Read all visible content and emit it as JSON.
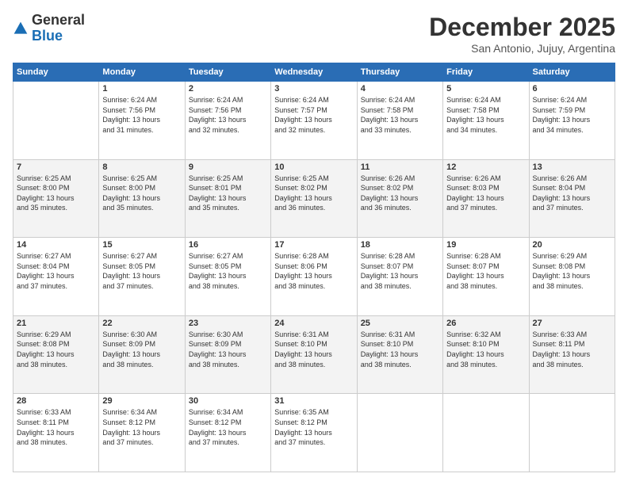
{
  "logo": {
    "general": "General",
    "blue": "Blue"
  },
  "header": {
    "month": "December 2025",
    "location": "San Antonio, Jujuy, Argentina"
  },
  "weekdays": [
    "Sunday",
    "Monday",
    "Tuesday",
    "Wednesday",
    "Thursday",
    "Friday",
    "Saturday"
  ],
  "weeks": [
    [
      {
        "day": "",
        "info": ""
      },
      {
        "day": "1",
        "info": "Sunrise: 6:24 AM\nSunset: 7:56 PM\nDaylight: 13 hours\nand 31 minutes."
      },
      {
        "day": "2",
        "info": "Sunrise: 6:24 AM\nSunset: 7:56 PM\nDaylight: 13 hours\nand 32 minutes."
      },
      {
        "day": "3",
        "info": "Sunrise: 6:24 AM\nSunset: 7:57 PM\nDaylight: 13 hours\nand 32 minutes."
      },
      {
        "day": "4",
        "info": "Sunrise: 6:24 AM\nSunset: 7:58 PM\nDaylight: 13 hours\nand 33 minutes."
      },
      {
        "day": "5",
        "info": "Sunrise: 6:24 AM\nSunset: 7:58 PM\nDaylight: 13 hours\nand 34 minutes."
      },
      {
        "day": "6",
        "info": "Sunrise: 6:24 AM\nSunset: 7:59 PM\nDaylight: 13 hours\nand 34 minutes."
      }
    ],
    [
      {
        "day": "7",
        "info": "Sunrise: 6:25 AM\nSunset: 8:00 PM\nDaylight: 13 hours\nand 35 minutes."
      },
      {
        "day": "8",
        "info": "Sunrise: 6:25 AM\nSunset: 8:00 PM\nDaylight: 13 hours\nand 35 minutes."
      },
      {
        "day": "9",
        "info": "Sunrise: 6:25 AM\nSunset: 8:01 PM\nDaylight: 13 hours\nand 35 minutes."
      },
      {
        "day": "10",
        "info": "Sunrise: 6:25 AM\nSunset: 8:02 PM\nDaylight: 13 hours\nand 36 minutes."
      },
      {
        "day": "11",
        "info": "Sunrise: 6:26 AM\nSunset: 8:02 PM\nDaylight: 13 hours\nand 36 minutes."
      },
      {
        "day": "12",
        "info": "Sunrise: 6:26 AM\nSunset: 8:03 PM\nDaylight: 13 hours\nand 37 minutes."
      },
      {
        "day": "13",
        "info": "Sunrise: 6:26 AM\nSunset: 8:04 PM\nDaylight: 13 hours\nand 37 minutes."
      }
    ],
    [
      {
        "day": "14",
        "info": "Sunrise: 6:27 AM\nSunset: 8:04 PM\nDaylight: 13 hours\nand 37 minutes."
      },
      {
        "day": "15",
        "info": "Sunrise: 6:27 AM\nSunset: 8:05 PM\nDaylight: 13 hours\nand 37 minutes."
      },
      {
        "day": "16",
        "info": "Sunrise: 6:27 AM\nSunset: 8:05 PM\nDaylight: 13 hours\nand 38 minutes."
      },
      {
        "day": "17",
        "info": "Sunrise: 6:28 AM\nSunset: 8:06 PM\nDaylight: 13 hours\nand 38 minutes."
      },
      {
        "day": "18",
        "info": "Sunrise: 6:28 AM\nSunset: 8:07 PM\nDaylight: 13 hours\nand 38 minutes."
      },
      {
        "day": "19",
        "info": "Sunrise: 6:28 AM\nSunset: 8:07 PM\nDaylight: 13 hours\nand 38 minutes."
      },
      {
        "day": "20",
        "info": "Sunrise: 6:29 AM\nSunset: 8:08 PM\nDaylight: 13 hours\nand 38 minutes."
      }
    ],
    [
      {
        "day": "21",
        "info": "Sunrise: 6:29 AM\nSunset: 8:08 PM\nDaylight: 13 hours\nand 38 minutes."
      },
      {
        "day": "22",
        "info": "Sunrise: 6:30 AM\nSunset: 8:09 PM\nDaylight: 13 hours\nand 38 minutes."
      },
      {
        "day": "23",
        "info": "Sunrise: 6:30 AM\nSunset: 8:09 PM\nDaylight: 13 hours\nand 38 minutes."
      },
      {
        "day": "24",
        "info": "Sunrise: 6:31 AM\nSunset: 8:10 PM\nDaylight: 13 hours\nand 38 minutes."
      },
      {
        "day": "25",
        "info": "Sunrise: 6:31 AM\nSunset: 8:10 PM\nDaylight: 13 hours\nand 38 minutes."
      },
      {
        "day": "26",
        "info": "Sunrise: 6:32 AM\nSunset: 8:10 PM\nDaylight: 13 hours\nand 38 minutes."
      },
      {
        "day": "27",
        "info": "Sunrise: 6:33 AM\nSunset: 8:11 PM\nDaylight: 13 hours\nand 38 minutes."
      }
    ],
    [
      {
        "day": "28",
        "info": "Sunrise: 6:33 AM\nSunset: 8:11 PM\nDaylight: 13 hours\nand 38 minutes."
      },
      {
        "day": "29",
        "info": "Sunrise: 6:34 AM\nSunset: 8:12 PM\nDaylight: 13 hours\nand 37 minutes."
      },
      {
        "day": "30",
        "info": "Sunrise: 6:34 AM\nSunset: 8:12 PM\nDaylight: 13 hours\nand 37 minutes."
      },
      {
        "day": "31",
        "info": "Sunrise: 6:35 AM\nSunset: 8:12 PM\nDaylight: 13 hours\nand 37 minutes."
      },
      {
        "day": "",
        "info": ""
      },
      {
        "day": "",
        "info": ""
      },
      {
        "day": "",
        "info": ""
      }
    ]
  ]
}
